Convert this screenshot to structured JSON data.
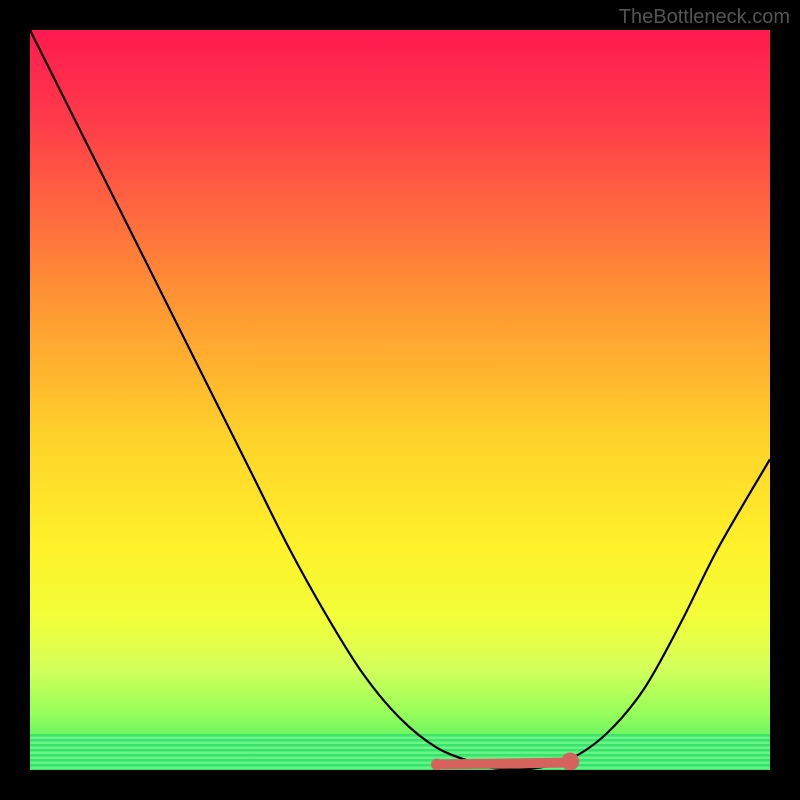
{
  "attribution": "TheBottleneck.com",
  "chart_data": {
    "type": "line",
    "title": "",
    "xlabel": "",
    "ylabel": "",
    "xlim": [
      0,
      100
    ],
    "ylim": [
      0,
      100
    ],
    "x": [
      0,
      5,
      10,
      15,
      20,
      25,
      30,
      35,
      40,
      45,
      50,
      55,
      60,
      63,
      68,
      73,
      78,
      83,
      88,
      93,
      100
    ],
    "values": [
      100,
      90,
      80,
      70,
      60,
      50,
      40,
      30,
      21,
      13,
      7,
      3,
      1,
      0.2,
      0.2,
      1.5,
      5,
      11,
      20,
      30,
      42
    ],
    "optimal_range": {
      "x_start": 55,
      "x_end": 73,
      "y": 0.2
    },
    "gradient_colors": {
      "top": "#ff1a4f",
      "middle": "#ffd22a",
      "bottom": "#35e96b"
    }
  }
}
